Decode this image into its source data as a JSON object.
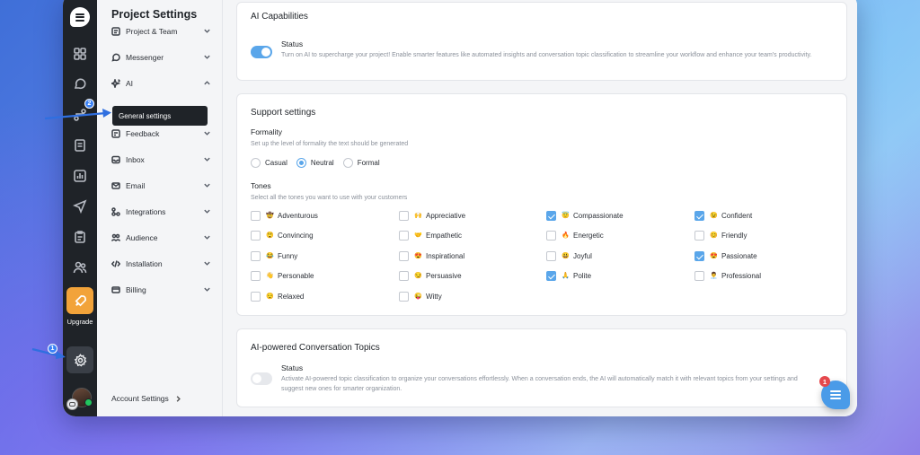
{
  "nav": {
    "title": "Project Settings",
    "items": [
      {
        "label": "Project & Team",
        "icon": "project-team-icon",
        "expanded": false
      },
      {
        "label": "Messenger",
        "icon": "messenger-icon",
        "expanded": false
      },
      {
        "label": "AI",
        "icon": "ai-sparkle-icon",
        "expanded": true
      },
      {
        "label": "Feedback",
        "icon": "feedback-icon",
        "expanded": false
      },
      {
        "label": "Inbox",
        "icon": "inbox-icon",
        "expanded": false
      },
      {
        "label": "Email",
        "icon": "email-icon",
        "expanded": false
      },
      {
        "label": "Integrations",
        "icon": "integrations-icon",
        "expanded": false
      },
      {
        "label": "Audience",
        "icon": "audience-icon",
        "expanded": false
      },
      {
        "label": "Installation",
        "icon": "code-icon",
        "expanded": false
      },
      {
        "label": "Billing",
        "icon": "billing-icon",
        "expanded": false
      }
    ],
    "sub_item": "General settings",
    "account_settings": "Account Settings"
  },
  "rail": {
    "upgrade_label": "Upgrade",
    "badge_settings": "1",
    "badge_general": "2"
  },
  "ai_capabilities": {
    "title": "AI Capabilities",
    "status_label": "Status",
    "status_desc": "Turn on AI to supercharge your project! Enable smarter features like automated insights and conversation topic classification to streamline your workflow and enhance your team's productivity.",
    "enabled": true
  },
  "support": {
    "title": "Support settings",
    "formality_label": "Formality",
    "formality_desc": "Set up the level of formality the text should be generated",
    "formality_options": [
      "Casual",
      "Neutral",
      "Formal"
    ],
    "formality_selected": "Neutral",
    "tones_label": "Tones",
    "tones_desc": "Select all the tones you want to use with your customers",
    "tones": [
      {
        "label": "Adventurous",
        "emoji": "🤠",
        "checked": false
      },
      {
        "label": "Appreciative",
        "emoji": "🙌",
        "checked": false
      },
      {
        "label": "Compassionate",
        "emoji": "😇",
        "checked": true
      },
      {
        "label": "Confident",
        "emoji": "😉",
        "checked": true
      },
      {
        "label": "Convincing",
        "emoji": "😲",
        "checked": false
      },
      {
        "label": "Empathetic",
        "emoji": "🤝",
        "checked": false
      },
      {
        "label": "Energetic",
        "emoji": "🔥",
        "checked": false
      },
      {
        "label": "Friendly",
        "emoji": "😊",
        "checked": false
      },
      {
        "label": "Funny",
        "emoji": "😂",
        "checked": false
      },
      {
        "label": "Inspirational",
        "emoji": "😍",
        "checked": false
      },
      {
        "label": "Joyful",
        "emoji": "😃",
        "checked": false
      },
      {
        "label": "Passionate",
        "emoji": "😍",
        "checked": true
      },
      {
        "label": "Personable",
        "emoji": "👋",
        "checked": false
      },
      {
        "label": "Persuasive",
        "emoji": "😏",
        "checked": false
      },
      {
        "label": "Polite",
        "emoji": "🙏",
        "checked": true
      },
      {
        "label": "Professional",
        "emoji": "👨‍💼",
        "checked": false
      },
      {
        "label": "Relaxed",
        "emoji": "😌",
        "checked": false
      },
      {
        "label": "Witty",
        "emoji": "😜",
        "checked": false
      }
    ]
  },
  "topics": {
    "title": "AI-powered Conversation Topics",
    "status_label": "Status",
    "status_desc": "Activate AI-powered topic classification to organize your conversations effortlessly. When a conversation ends, the AI will automatically match it with relevant topics from your settings and suggest new ones for smarter organization.",
    "enabled": false
  },
  "chat": {
    "badge": "1"
  },
  "colors": {
    "accent": "#5aa6ea",
    "rail": "#1f2328",
    "upgrade": "#f2a33a",
    "arrow": "#2f6fe0"
  }
}
